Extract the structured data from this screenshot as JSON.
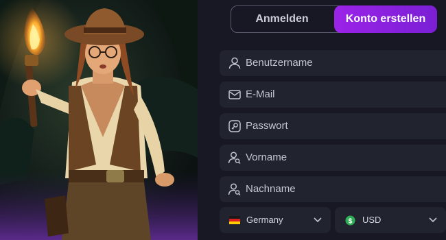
{
  "tabs": {
    "login_label": "Anmelden",
    "register_label": "Konto erstellen"
  },
  "form": {
    "username_placeholder": "Benutzername",
    "email_placeholder": "E-Mail",
    "password_placeholder": "Passwort",
    "firstname_placeholder": "Vorname",
    "lastname_placeholder": "Nachname",
    "country_value": "Germany",
    "currency_value": "USD"
  },
  "icons": {
    "username": "user-icon",
    "email": "envelope-icon",
    "password": "key-icon",
    "firstname": "user-search-icon",
    "lastname": "user-search-icon",
    "country": "germany-flag-icon",
    "currency": "dollar-coin-icon",
    "dropdown": "chevron-down-icon"
  },
  "colors": {
    "accent": "#8b22e0",
    "panel_bg": "#171823",
    "field_bg": "#21232f"
  }
}
